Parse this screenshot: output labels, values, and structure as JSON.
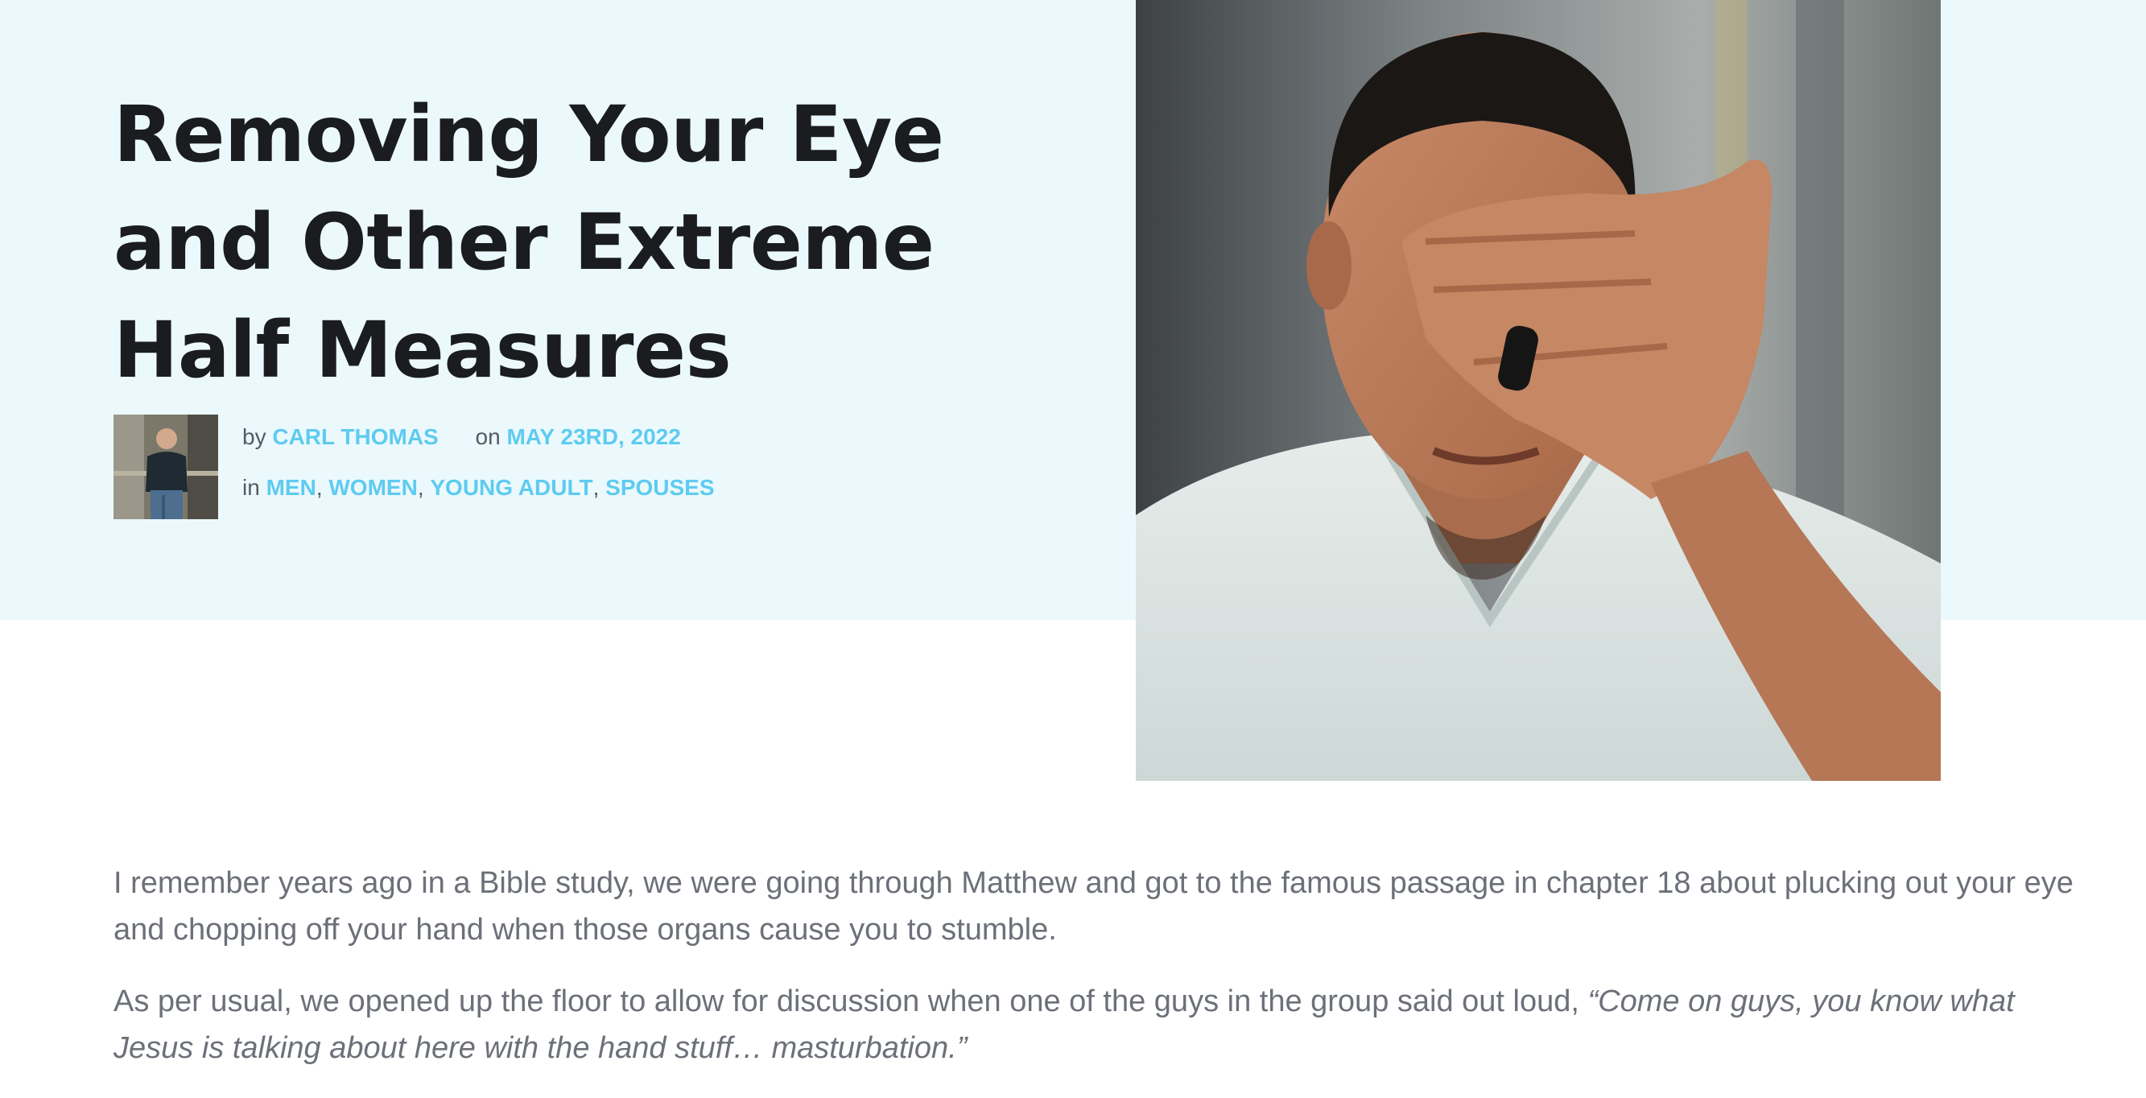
{
  "post": {
    "title_lines": [
      "Removing Your Eye",
      "and Other Extreme",
      "Half Measures"
    ],
    "by_word": "by",
    "author": "CARL THOMAS",
    "on_word": "on",
    "date": "MAY 23RD, 2022",
    "in_word": "in",
    "categories": [
      "MEN",
      "WOMEN",
      "YOUNG ADULT",
      "SPOUSES"
    ],
    "separator": ","
  },
  "article": {
    "paragraph1": "I remember years ago in a Bible study, we were going through Matthew and got to the famous passage in chapter 18 about plucking out your eye and chopping off your hand when those organs cause you to stumble.",
    "paragraph2_text": "As per usual, we opened up the floor to allow for discussion when one of the guys in the group said out loud, ",
    "paragraph2_quote": "“Come on guys, you know what Jesus is talking about here with the hand stuff… masturbation.”"
  },
  "colors": {
    "hero_background": "#ebf9fd",
    "title": "#1b1c20",
    "link_accent": "#5ecbf0",
    "body_text": "#6c7079"
  },
  "images": {
    "author_avatar": "author-photo",
    "hero_photo": "man-covering-eye-photo"
  }
}
